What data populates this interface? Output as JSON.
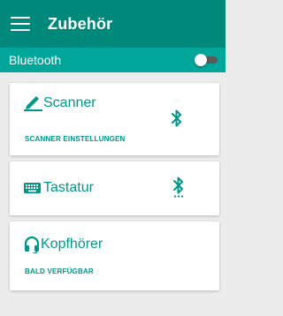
{
  "appbar": {
    "title": "Zubehör",
    "menu_icon": "hamburger-menu-icon"
  },
  "bluetooth": {
    "label": "Bluetooth",
    "toggle_state": "off"
  },
  "cards": [
    {
      "title": "Scanner",
      "icon": "pencil-scanner-icon",
      "subtitle": "SCANNER EINSTELLUNGEN",
      "status_icon": "bluetooth-icon"
    },
    {
      "title": "Tastatur",
      "icon": "keyboard-icon",
      "status_icon": "bluetooth-searching-icon"
    },
    {
      "title": "Kopfhörer",
      "icon": "headset-icon",
      "subtitle": "BALD VERFÜGBAR"
    }
  ],
  "colors": {
    "appbar": "#00897b",
    "bluetooth_bar": "#00a69a",
    "accent": "#009688",
    "background": "#ececec"
  }
}
